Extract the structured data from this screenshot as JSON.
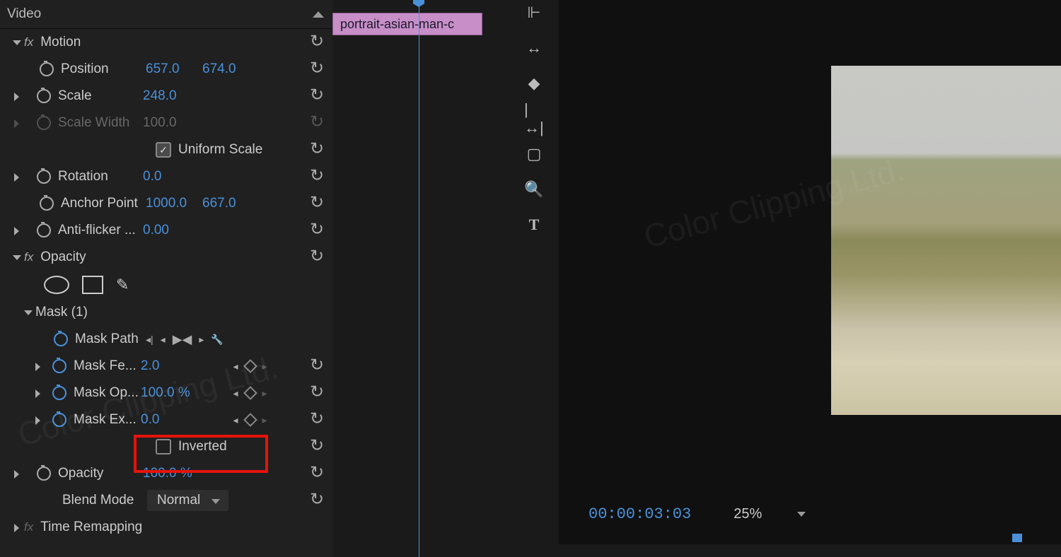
{
  "panel": {
    "video_header": "Video",
    "motion": {
      "title": "Motion",
      "position_label": "Position",
      "position_x": "657.0",
      "position_y": "674.0",
      "scale_label": "Scale",
      "scale_val": "248.0",
      "scale_width_label": "Scale Width",
      "scale_width_val": "100.0",
      "uniform_label": "Uniform Scale",
      "rotation_label": "Rotation",
      "rotation_val": "0.0",
      "anchor_label": "Anchor Point",
      "anchor_x": "1000.0",
      "anchor_y": "667.0",
      "antiflicker_label": "Anti-flicker ...",
      "antiflicker_val": "0.00"
    },
    "opacity": {
      "title": "Opacity",
      "mask_title": "Mask (1)",
      "mask_path_label": "Mask Path",
      "mask_feather_label": "Mask Fe...",
      "mask_feather_val": "2.0",
      "mask_opacity_label": "Mask Op...",
      "mask_opacity_val": "100.0 %",
      "mask_expansion_label": "Mask Ex...",
      "mask_expansion_val": "0.0",
      "inverted_label": "Inverted",
      "opacity_label": "Opacity",
      "opacity_val": "100.0 %",
      "blend_label": "Blend Mode",
      "blend_val": "Normal"
    },
    "time_remapping": "Time Remapping"
  },
  "timeline": {
    "clip_name": "portrait-asian-man-c"
  },
  "monitor": {
    "timecode": "00:00:03:03",
    "zoom": "25%"
  },
  "watermarks": {
    "w1": "Color Clipping Ltd.",
    "w2": "Color Clipping Ltd."
  }
}
